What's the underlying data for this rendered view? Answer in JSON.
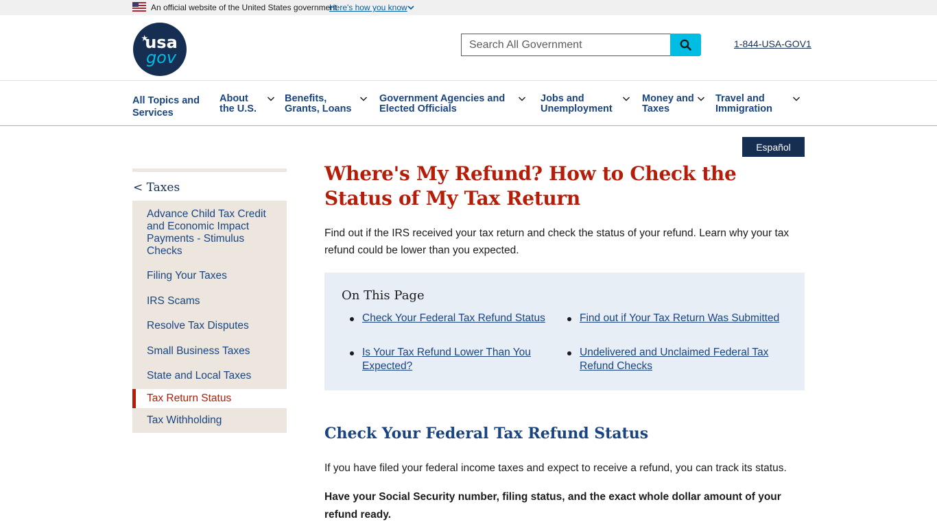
{
  "banner": {
    "official_text": "An official website of the United States government",
    "how_you_know": "Here's how you know"
  },
  "header": {
    "logo_text_top": "usa",
    "logo_text_bottom": "gov",
    "search_placeholder": "Search All Government",
    "phone": "1-844-USA-GOV1"
  },
  "nav": {
    "items": [
      {
        "line1": "All Topics and",
        "line2": "Services"
      },
      {
        "line1": "About",
        "line2": "the U.S."
      },
      {
        "line1": "Benefits,",
        "line2": "Grants, Loans"
      },
      {
        "line1": "Government Agencies and",
        "line2": "Elected Officials"
      },
      {
        "line1": "Jobs and",
        "line2": "Unemployment"
      },
      {
        "line1": "Money and",
        "line2": "Taxes"
      },
      {
        "line1": "Travel and",
        "line2": "Immigration"
      }
    ]
  },
  "language_button": "Español",
  "sidebar": {
    "parent": "< Taxes",
    "items": [
      "Advance Child Tax Credit and Economic Impact Payments - Stimulus Checks",
      "Filing Your Taxes",
      "IRS Scams",
      "Resolve Tax Disputes",
      "Small Business Taxes",
      "State and Local Taxes",
      "Tax Return Status",
      "Tax Withholding"
    ]
  },
  "main": {
    "title": "Where's My Refund? How to Check the Status of My Tax Return",
    "intro": "Find out if the IRS received your tax return and check the status of your refund. Learn why your tax refund could be lower than you expected.",
    "on_this_page": {
      "heading": "On This Page",
      "links": [
        "Check Your Federal Tax Refund Status",
        "Find out if Your Tax Return Was Submitted",
        "Is Your Tax Refund Lower Than You Expected?",
        "Undelivered and Unclaimed Federal Tax Refund Checks"
      ]
    },
    "section_heading": "Check Your Federal Tax Refund Status",
    "paragraph1": "If you have filed your federal income taxes and expect to receive a refund, you can track its status.",
    "paragraph2": "Have your Social Security number, filing status, and the exact whole dollar amount of your refund ready."
  },
  "colors": {
    "title_red": "#b51d09",
    "navy": "#162e51",
    "link_blue": "#1a4480",
    "search_cyan": "#00bde3",
    "sidebar_bg": "#ece6df",
    "otp_bg": "#e7eef6"
  },
  "icons": [
    "us-flag-icon",
    "chevron-down-icon",
    "search-icon",
    "usagov-logo"
  ]
}
